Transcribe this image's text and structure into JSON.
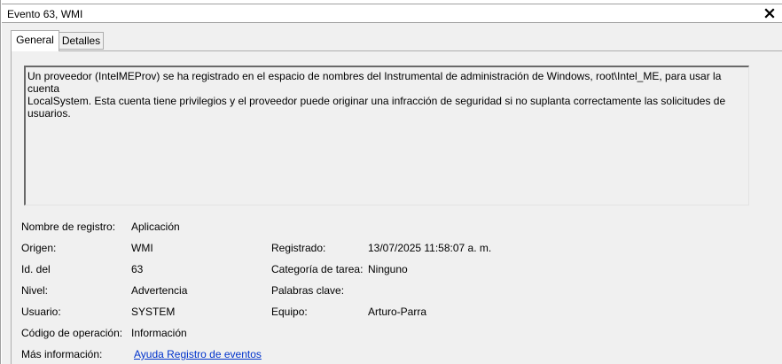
{
  "window": {
    "title": "Evento 63, WMI",
    "close_icon": "close-icon"
  },
  "tabs": [
    {
      "label": "General",
      "active": true
    },
    {
      "label": "Detalles",
      "active": false
    }
  ],
  "description": "Un proveedor (IntelMEProv) se ha registrado en el espacio de nombres del Instrumental de administración de Windows, root\\Intel_ME, para usar la cuenta\nLocalSystem. Esta cuenta tiene privilegios y el proveedor puede originar una infracción de seguridad si no suplanta correctamente las solicitudes de\nusuarios.",
  "fields": {
    "log_name": {
      "label": "Nombre de registro:",
      "value": "Aplicación"
    },
    "source": {
      "label": "Origen:",
      "value": "WMI"
    },
    "logged": {
      "label": "Registrado:",
      "value": "13/07/2025 11:58:07 a. m."
    },
    "event_id": {
      "label": "Id. del",
      "value": "63"
    },
    "task_category": {
      "label": "Categoría de tarea:",
      "value": "Ninguno"
    },
    "level": {
      "label": "Nivel:",
      "value": "Advertencia"
    },
    "keywords": {
      "label": "Palabras clave:",
      "value": ""
    },
    "user": {
      "label": "Usuario:",
      "value": "SYSTEM"
    },
    "computer": {
      "label": "Equipo:",
      "value": "Arturo-Parra"
    },
    "opcode": {
      "label": "Código de operación:",
      "value": "Información"
    },
    "more_info": {
      "label": "Más información:",
      "link": "Ayuda Registro de eventos"
    }
  },
  "colors": {
    "link": "#0033cc",
    "background": "#f0f0f0"
  }
}
